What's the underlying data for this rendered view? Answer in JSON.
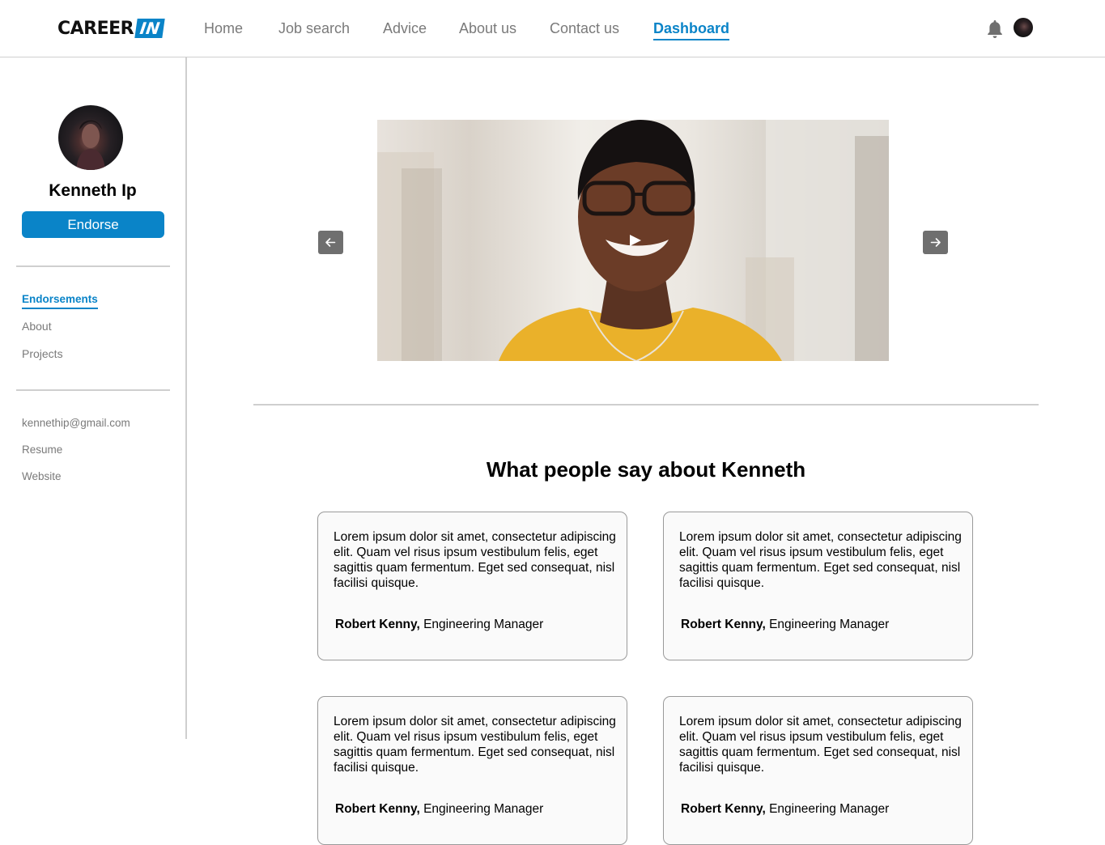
{
  "header": {
    "logo_primary": "CAREER",
    "logo_badge": "IN",
    "nav": [
      {
        "label": "Home",
        "active": false
      },
      {
        "label": "Job search",
        "active": false
      },
      {
        "label": "Advice",
        "active": false
      },
      {
        "label": "About us",
        "active": false
      },
      {
        "label": "Contact us",
        "active": false
      },
      {
        "label": "Dashboard",
        "active": true
      }
    ],
    "icons": {
      "notifications": "bell-icon",
      "user": "avatar"
    }
  },
  "sidebar": {
    "name": "Kenneth Ip",
    "endorse_label": "Endorse",
    "sections": [
      {
        "label": "Endorsements",
        "active": true
      },
      {
        "label": "About",
        "active": false
      },
      {
        "label": "Projects",
        "active": false
      }
    ],
    "contacts": [
      {
        "label": "kennethip@gmail.com"
      },
      {
        "label": "Resume"
      },
      {
        "label": "Website"
      }
    ]
  },
  "main": {
    "video": {
      "icons": [
        "play-icon",
        "arrow-left-icon",
        "arrow-right-icon"
      ]
    },
    "section_title": "What people say about Kenneth",
    "testimonials": [
      {
        "text": "Lorem ipsum dolor sit amet, consectetur adipiscing elit. Quam vel risus ipsum vestibulum felis, eget sagittis quam fermentum. Eget sed consequat, nisl facilisi quisque.",
        "author": "Robert Kenny,",
        "role": "Engineering Manager"
      },
      {
        "text": "Lorem ipsum dolor sit amet, consectetur adipiscing elit. Quam vel risus ipsum vestibulum felis, eget sagittis quam fermentum. Eget sed consequat, nisl facilisi quisque.",
        "author": "Robert Kenny,",
        "role": "Engineering Manager"
      },
      {
        "text": "Lorem ipsum dolor sit amet, consectetur adipiscing elit. Quam vel risus ipsum vestibulum felis, eget sagittis quam fermentum. Eget sed consequat, nisl facilisi quisque.",
        "author": "Robert Kenny,",
        "role": "Engineering Manager"
      },
      {
        "text": "Lorem ipsum dolor sit amet, consectetur adipiscing elit. Quam vel risus ipsum vestibulum felis, eget sagittis quam fermentum. Eget sed consequat, nisl facilisi quisque.",
        "author": "Robert Kenny,",
        "role": "Engineering Manager"
      }
    ]
  },
  "colors": {
    "accent": "#0a84c8",
    "muted_text": "#7a7a7a",
    "divider": "#cfcfcf",
    "arrow_button": "#6f6f6f"
  }
}
